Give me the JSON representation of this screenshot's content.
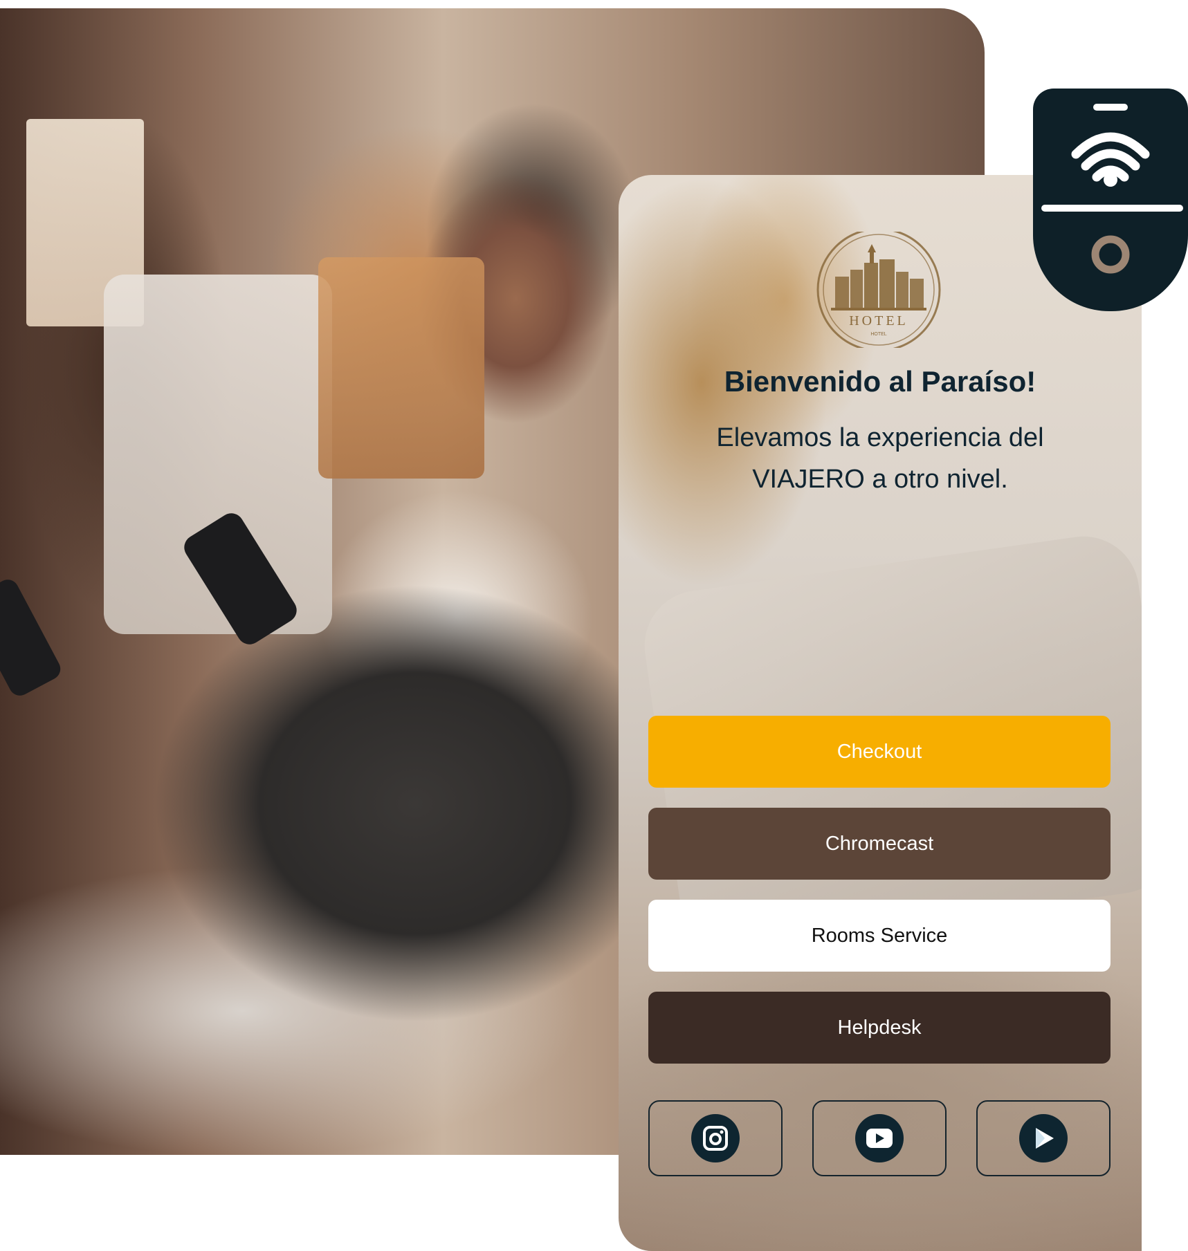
{
  "background": {
    "icons": [
      "smartphone",
      "smartphone"
    ]
  },
  "app": {
    "logo": {
      "icon": "hotel-logo-icon",
      "text": "HOTEL",
      "subtext": "HOTEL"
    },
    "welcome_title": "Bienvenido al Paraíso!",
    "welcome_subtitle": "Elevamos la experiencia del VIAJERO a otro nivel.",
    "buttons": {
      "checkout": "Checkout",
      "chromecast": "Chromecast",
      "rooms_service": "Rooms Service",
      "helpdesk": "Helpdesk"
    },
    "social": [
      {
        "icon": "instagram-icon"
      },
      {
        "icon": "youtube-icon"
      },
      {
        "icon": "play-store-icon"
      }
    ]
  },
  "wifi_badge": {
    "icon": "wifi-icon"
  },
  "colors": {
    "checkout": "#f7ae00",
    "chromecast": "#5c4538",
    "rooms_service": "#ffffff",
    "helpdesk": "#3b2b25",
    "title": "#0f2431",
    "badge": "#0e2028",
    "accent_gold": "#8a6a3c"
  }
}
